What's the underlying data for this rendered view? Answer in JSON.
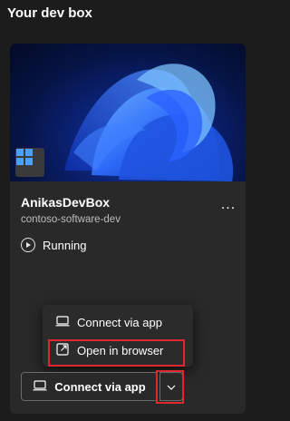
{
  "page": {
    "title": "Your dev box"
  },
  "devbox": {
    "name": "AnikasDevBox",
    "project": "contoso-software-dev",
    "status": "Running",
    "more_label": "..."
  },
  "menu": {
    "items": [
      {
        "label": "Connect via app",
        "icon": "laptop-icon"
      },
      {
        "label": "Open in browser",
        "icon": "open-external-icon"
      }
    ]
  },
  "connect": {
    "label": "Connect via app",
    "icon": "laptop-icon",
    "dropdown_icon": "chevron-down-icon"
  },
  "colors": {
    "highlight": "#e0262e",
    "card": "#292929",
    "background": "#1c1c1c"
  }
}
